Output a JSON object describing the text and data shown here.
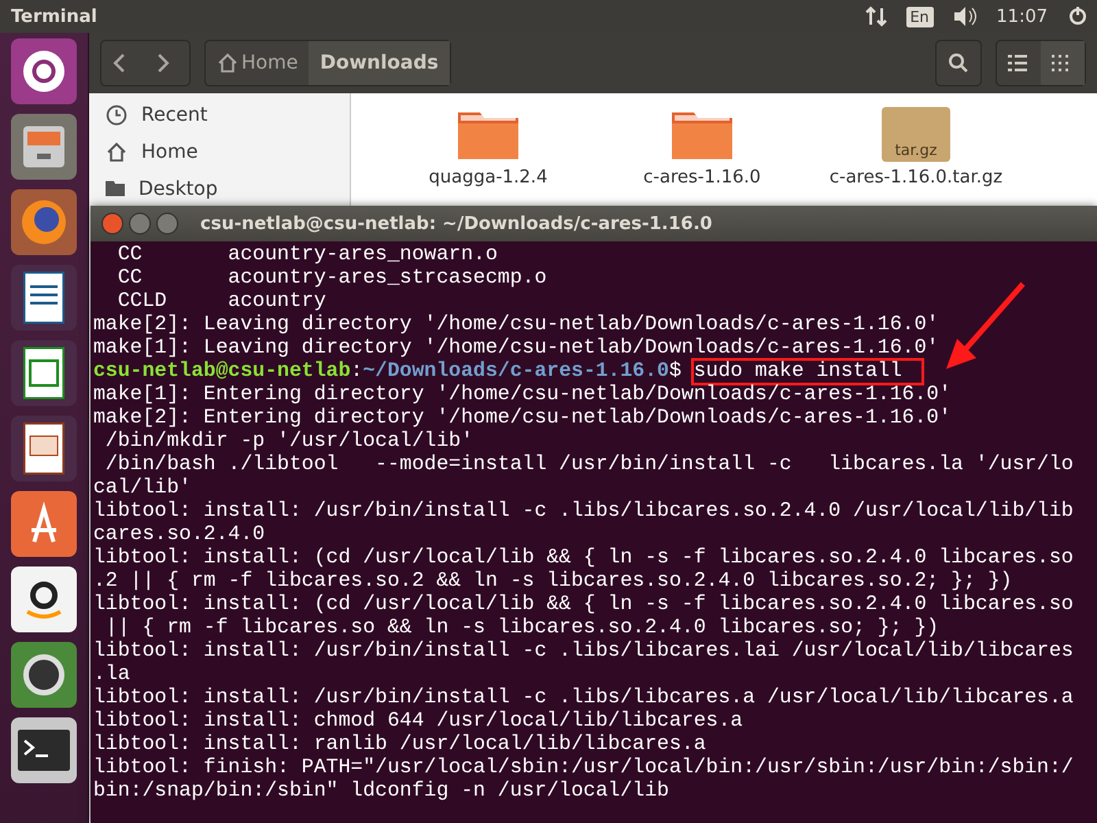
{
  "top_panel": {
    "title": "Terminal",
    "keyboard": "En",
    "clock": "11:07"
  },
  "launcher": [
    {
      "kind": "dash"
    },
    {
      "kind": "files"
    },
    {
      "kind": "browser"
    },
    {
      "kind": "writer"
    },
    {
      "kind": "calc"
    },
    {
      "kind": "impress"
    },
    {
      "kind": "store"
    },
    {
      "kind": "amazon"
    },
    {
      "kind": "updater"
    },
    {
      "kind": "terminal"
    }
  ],
  "file_manager": {
    "breadcrumbs": [
      {
        "label": "Home",
        "selected": false
      },
      {
        "label": "Downloads",
        "selected": true
      }
    ],
    "view": [
      {
        "kind": "list",
        "selected": false
      },
      {
        "kind": "grid",
        "selected": true
      }
    ],
    "sidebar": [
      {
        "label": "Recent",
        "kind": "recent"
      },
      {
        "label": "Home",
        "kind": "home"
      },
      {
        "label": "Desktop",
        "kind": "folder"
      }
    ],
    "files": [
      {
        "name": "quagga-1.2.4",
        "kind": "folder"
      },
      {
        "name": "c-ares-1.16.0",
        "kind": "folder"
      },
      {
        "name": "c-ares-1.16.0.tar.gz",
        "kind": "archive",
        "badge": "tar.gz"
      }
    ]
  },
  "terminal": {
    "title": "csu-netlab@csu-netlab: ~/Downloads/c-ares-1.16.0",
    "lines": [
      {
        "kind": "output",
        "text": "  CC       acountry-ares_nowarn.o"
      },
      {
        "kind": "output",
        "text": "  CC       acountry-ares_strcasecmp.o"
      },
      {
        "kind": "output",
        "text": "  CCLD     acountry"
      },
      {
        "kind": "output",
        "text": "make[2]: Leaving directory '/home/csu-netlab/Downloads/c-ares-1.16.0'"
      },
      {
        "kind": "output",
        "text": "make[1]: Leaving directory '/home/csu-netlab/Downloads/c-ares-1.16.0'"
      },
      {
        "kind": "prompt",
        "user": "csu-netlab@csu-netlab",
        "sep": ":",
        "path": "~/Downloads/c-ares-1.16.0",
        "suffix": "$",
        "command": "sudo make install",
        "boxed": true
      },
      {
        "kind": "output",
        "text": "make[1]: Entering directory '/home/csu-netlab/Downloads/c-ares-1.16.0'"
      },
      {
        "kind": "output",
        "text": "make[2]: Entering directory '/home/csu-netlab/Downloads/c-ares-1.16.0'"
      },
      {
        "kind": "output",
        "text": " /bin/mkdir -p '/usr/local/lib'"
      },
      {
        "kind": "output",
        "text": " /bin/bash ./libtool   --mode=install /usr/bin/install -c   libcares.la '/usr/lo"
      },
      {
        "kind": "output",
        "text": "cal/lib'"
      },
      {
        "kind": "output",
        "text": "libtool: install: /usr/bin/install -c .libs/libcares.so.2.4.0 /usr/local/lib/lib"
      },
      {
        "kind": "output",
        "text": "cares.so.2.4.0"
      },
      {
        "kind": "output",
        "text": "libtool: install: (cd /usr/local/lib && { ln -s -f libcares.so.2.4.0 libcares.so"
      },
      {
        "kind": "output",
        "text": ".2 || { rm -f libcares.so.2 && ln -s libcares.so.2.4.0 libcares.so.2; }; })"
      },
      {
        "kind": "output",
        "text": "libtool: install: (cd /usr/local/lib && { ln -s -f libcares.so.2.4.0 libcares.so"
      },
      {
        "kind": "output",
        "text": " || { rm -f libcares.so && ln -s libcares.so.2.4.0 libcares.so; }; })"
      },
      {
        "kind": "output",
        "text": "libtool: install: /usr/bin/install -c .libs/libcares.lai /usr/local/lib/libcares"
      },
      {
        "kind": "output",
        "text": ".la"
      },
      {
        "kind": "output",
        "text": "libtool: install: /usr/bin/install -c .libs/libcares.a /usr/local/lib/libcares.a"
      },
      {
        "kind": "output",
        "text": "libtool: install: chmod 644 /usr/local/lib/libcares.a"
      },
      {
        "kind": "output",
        "text": "libtool: install: ranlib /usr/local/lib/libcares.a"
      },
      {
        "kind": "output",
        "text": "libtool: finish: PATH=\"/usr/local/sbin:/usr/local/bin:/usr/sbin:/usr/bin:/sbin:/"
      },
      {
        "kind": "output",
        "text": "bin:/snap/bin:/sbin\" ldconfig -n /usr/local/lib"
      }
    ]
  }
}
